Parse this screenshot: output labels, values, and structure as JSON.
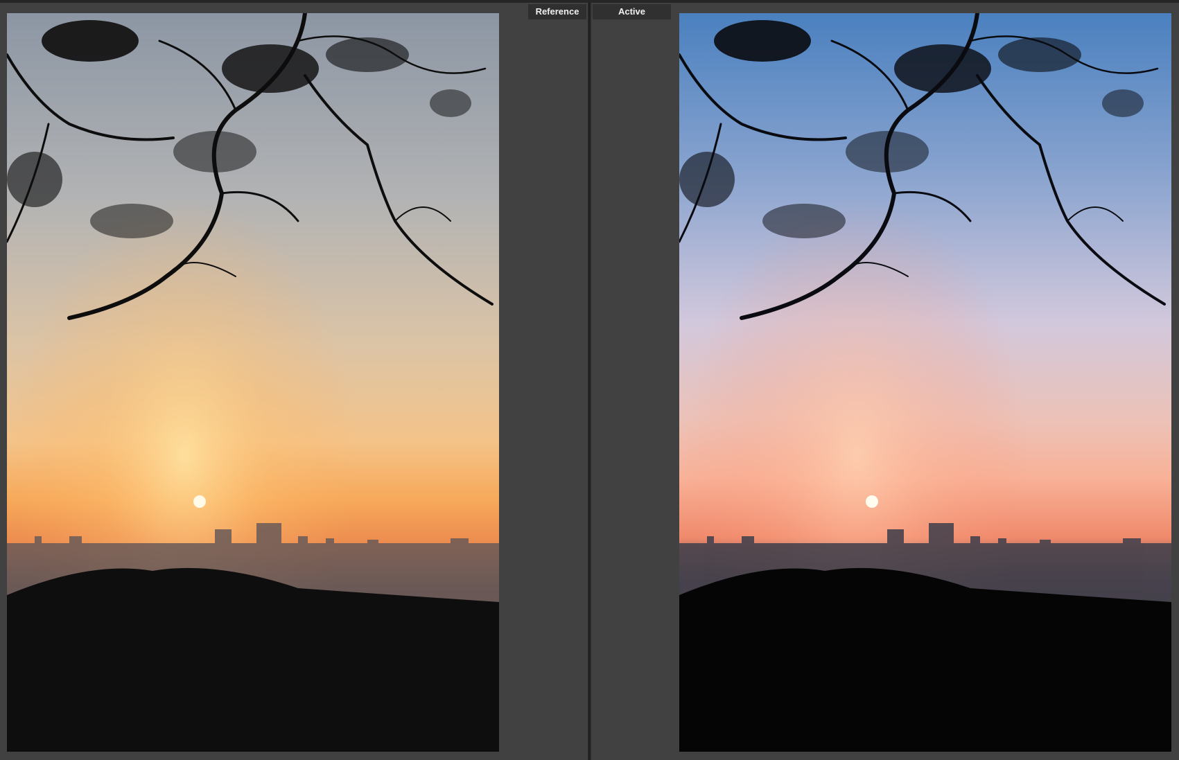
{
  "compare_view": {
    "reference_label": "Reference",
    "active_label": "Active",
    "accent_colors": {
      "reference_sky_top": "#8e98a6",
      "reference_sky_mid": "#e9c9a6",
      "reference_horizon": "#f5a04f",
      "active_sky_top": "#4a80bf",
      "active_sky_mid": "#d9c6d8",
      "active_horizon": "#f58f6f"
    }
  }
}
